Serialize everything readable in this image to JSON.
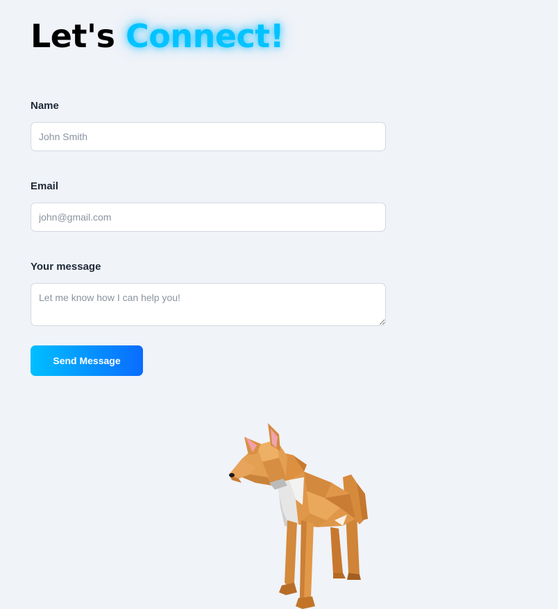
{
  "header": {
    "title_prefix": "Let's",
    "title_accent": "Connect!"
  },
  "form": {
    "name": {
      "label": "Name",
      "placeholder": "John Smith"
    },
    "email": {
      "label": "Email",
      "placeholder": "john@gmail.com"
    },
    "message": {
      "label": "Your message",
      "placeholder": "Let me know how I can help you!"
    },
    "submit_label": "Send Message"
  },
  "illustration": {
    "icon": "low-poly-fox-3d-model"
  },
  "colors": {
    "background": "#f0f3f8",
    "accent": "#00c3ff",
    "button_start": "#00bfff",
    "button_end": "#0a6cff"
  }
}
